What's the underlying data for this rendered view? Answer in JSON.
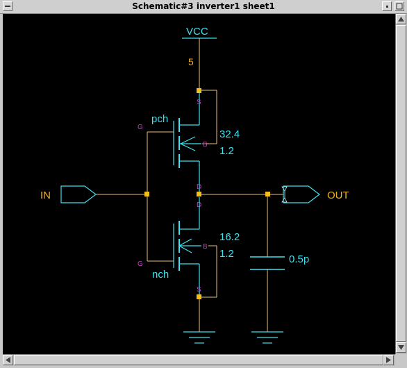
{
  "window": {
    "title": "Schematic#3 inverter1 sheet1"
  },
  "colors": {
    "background": "#000000",
    "wire": "#f0c070",
    "device": "#40e0f0",
    "net_label": "#f0b020",
    "pin_label": "#c040c0",
    "node": "#f0c020"
  },
  "schematic": {
    "supply": {
      "name": "VCC",
      "value": "5"
    },
    "pmos": {
      "model": "pch",
      "width": "32.4",
      "length": "1.2"
    },
    "nmos": {
      "model": "nch",
      "width": "16.2",
      "length": "1.2"
    },
    "capacitor": {
      "value": "0.5p"
    },
    "input_port": "IN",
    "output_port": "OUT",
    "pins": {
      "gate": "G",
      "source": "S",
      "drain": "D",
      "bulk": "B"
    }
  }
}
